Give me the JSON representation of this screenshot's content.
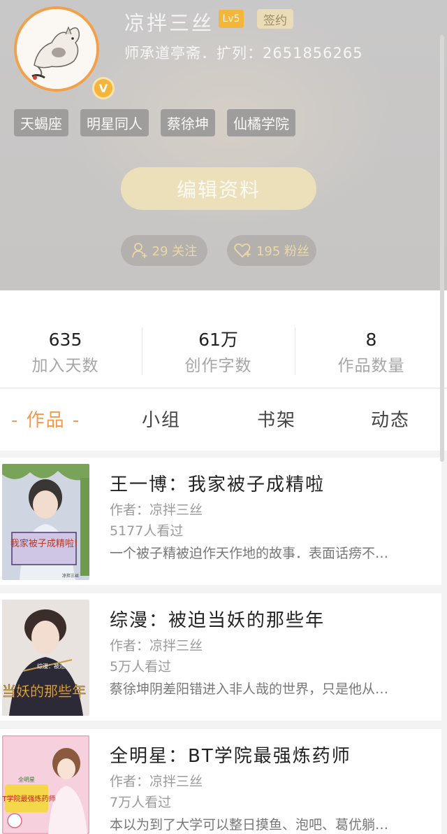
{
  "profile": {
    "username": "凉拌三丝",
    "level": "Lv5",
    "sign_badge": "签约",
    "subtitle": "师承道亭斋．扩列：2651856265",
    "avatar_badge": "V",
    "tags": [
      "天蝎座",
      "明星同人",
      "蔡徐坤",
      "仙橘学院"
    ],
    "edit_button": "编辑资料",
    "follow": "29 关注",
    "fans": "195 粉丝"
  },
  "stats": [
    {
      "value": "635",
      "label": "加入天数"
    },
    {
      "value": "61万",
      "label": "创作字数"
    },
    {
      "value": "8",
      "label": "作品数量"
    }
  ],
  "tabs": {
    "works": "- 作品 -",
    "group": "小组",
    "shelf": "书架",
    "activity": "动态"
  },
  "books": [
    {
      "title": "王一博：我家被子成精啦",
      "author": "作者：凉拌三丝",
      "views": "5177人看过",
      "desc": "一个被子精被迫作天作地的故事．表面话痨不…",
      "cover_text": "我家被子成精啦!",
      "cover_small": "凉拌三丝",
      "cover_colors": {
        "bg": "#cfd6e2",
        "accent": "#7aa35a"
      }
    },
    {
      "title": "综漫：被迫当妖的那些年",
      "author": "作者：凉拌三丝",
      "views": "5万人看过",
      "desc": "蔡徐坤阴差阳错进入非人哉的世界，只是他从…",
      "cover_text": "当妖的那些年",
      "cover_small": "综漫：被迫",
      "cover_colors": {
        "bg": "#e8e3df",
        "accent": "#c6a04a"
      }
    },
    {
      "title": "全明星：BT学院最强炼药师",
      "author": "作者：凉拌三丝",
      "views": "7万人看过",
      "desc": "本以为到了大学可以整日摸鱼、泡吧、葛优躺…",
      "cover_text": "BT学院最强炼药师",
      "cover_small": "全明星",
      "cover_colors": {
        "bg": "#f6d0dc",
        "accent": "#f5d84a"
      }
    }
  ]
}
